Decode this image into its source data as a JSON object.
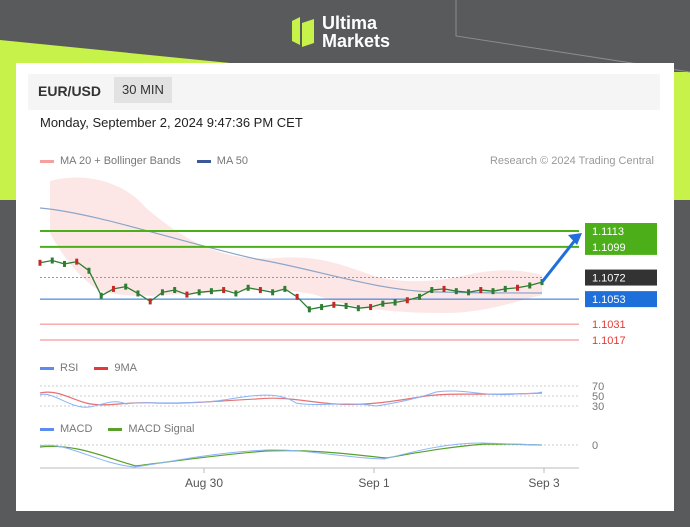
{
  "brand": {
    "line1": "Ultima",
    "line2": "Markets",
    "accent": "#c6f24a"
  },
  "header": {
    "pair": "EUR/USD",
    "timeframe": "30 MIN"
  },
  "datetime": "Monday, September 2, 2024 9:47:36 PM CET",
  "legend_main": [
    {
      "label": "MA 20 + Bollinger Bands",
      "color": "#f4a0a0"
    },
    {
      "label": "MA 50",
      "color": "#3b5998"
    }
  ],
  "credit": "Research © 2024 Trading Central",
  "legend_rsi": [
    {
      "label": "RSI",
      "color": "#5b8def"
    },
    {
      "label": "9MA",
      "color": "#e53935"
    }
  ],
  "legend_macd": [
    {
      "label": "MACD",
      "color": "#5b8def"
    },
    {
      "label": "MACD Signal",
      "color": "#5aa02c"
    }
  ],
  "chart_data": {
    "type": "line",
    "series": [
      {
        "values": [
          1.1085,
          1.1087,
          1.1084,
          1.1086,
          1.1078,
          1.1056,
          1.1062,
          1.1064,
          1.1058,
          1.1051,
          1.1059,
          1.1061,
          1.1057,
          1.1059,
          1.106,
          1.1061,
          1.1058,
          1.1063,
          1.1061,
          1.1059,
          1.1062,
          1.1055,
          1.1044,
          1.1046,
          1.1048,
          1.1047,
          1.1045,
          1.1046,
          1.1049,
          1.105,
          1.1052,
          1.1055,
          1.1061,
          1.1062,
          1.106,
          1.1059,
          1.1061,
          1.106,
          1.1062,
          1.1063,
          1.1065,
          1.1068
        ]
      }
    ],
    "levels": [
      {
        "value": 1.1113,
        "label": "1.1113",
        "color": "#4caf1a"
      },
      {
        "value": 1.1099,
        "label": "1.1099",
        "color": "#4caf1a"
      },
      {
        "value": 1.1072,
        "label": "1.1072",
        "color": "#333333"
      },
      {
        "value": 1.1053,
        "label": "1.1053",
        "color": "#1e6fd9"
      },
      {
        "value": 1.1031,
        "label": "1.1031",
        "color": "#f08080"
      },
      {
        "value": 1.1017,
        "label": "1.1017",
        "color": "#f08080"
      }
    ],
    "rsi_ticks": [
      "70",
      "50",
      "30"
    ],
    "macd_ticks": [
      "0"
    ],
    "x_ticks": [
      "Aug 30",
      "Sep 1",
      "Sep 3"
    ]
  }
}
